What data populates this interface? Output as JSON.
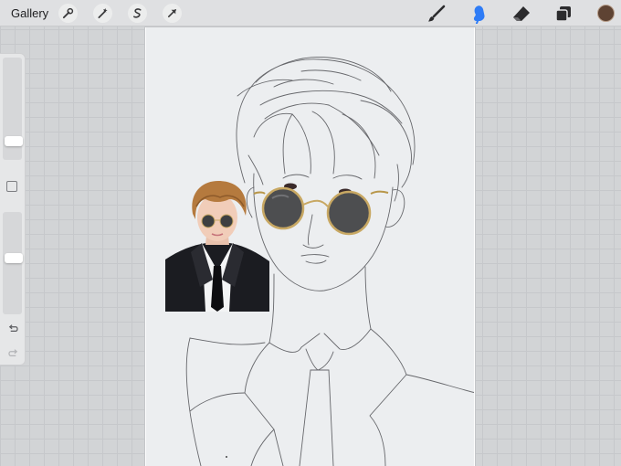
{
  "topbar": {
    "gallery_label": "Gallery",
    "left_tools": [
      "wrench-icon",
      "magic-wand-icon",
      "selection-icon",
      "transform-arrow-icon"
    ],
    "right_tools": [
      "brush-icon",
      "smudge-icon",
      "eraser-icon",
      "layers-icon"
    ],
    "active_tool": "smudge-icon",
    "current_color": "#5e4333",
    "accent_color": "#2e7cf6"
  },
  "sidebar": {
    "brush_size_level": 0.85,
    "opacity_level": 0.45,
    "controls": [
      "modify-button",
      "undo-icon",
      "redo-icon"
    ]
  },
  "canvas": {
    "background": "#eceef0",
    "layers": [
      "line-art-sketch",
      "sunglasses-cutout",
      "reference-photo"
    ]
  }
}
